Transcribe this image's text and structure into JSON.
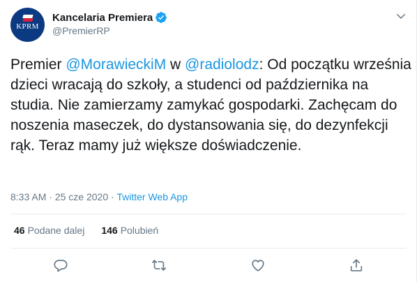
{
  "author": {
    "display_name": "Kancelaria Premiera",
    "handle": "@PremierRP",
    "avatar_text": "KPRM",
    "verified": true
  },
  "tweet": {
    "lead": "Premier ",
    "mention_1": "@MorawieckiM",
    "connector": " w ",
    "mention_2": "@radiolodz",
    "body": ": Od początku września dzieci wracają do szkoły, a studenci od października na studia. Nie zamierzamy zamykać gospodarki. Zachęcam do noszenia maseczek, do dystansowania się, do dezynfekcji rąk. Teraz mamy już większe doświadczenie."
  },
  "meta": {
    "time": "8:33 AM",
    "separator": " · ",
    "date": "25 cze 2020",
    "source": "Twitter Web App"
  },
  "stats": {
    "retweets_count": "46",
    "retweets_label": "Podane dalej",
    "likes_count": "146",
    "likes_label": "Polubień"
  },
  "colors": {
    "link": "#1b95e0",
    "secondary_text": "#657786",
    "primary_text": "#14171a",
    "avatar_bg": "#0c3a82",
    "verified": "#1da1f2"
  },
  "icons": [
    "verified-badge-icon",
    "chevron-down-icon",
    "reply-icon",
    "retweet-icon",
    "like-icon",
    "share-icon"
  ]
}
